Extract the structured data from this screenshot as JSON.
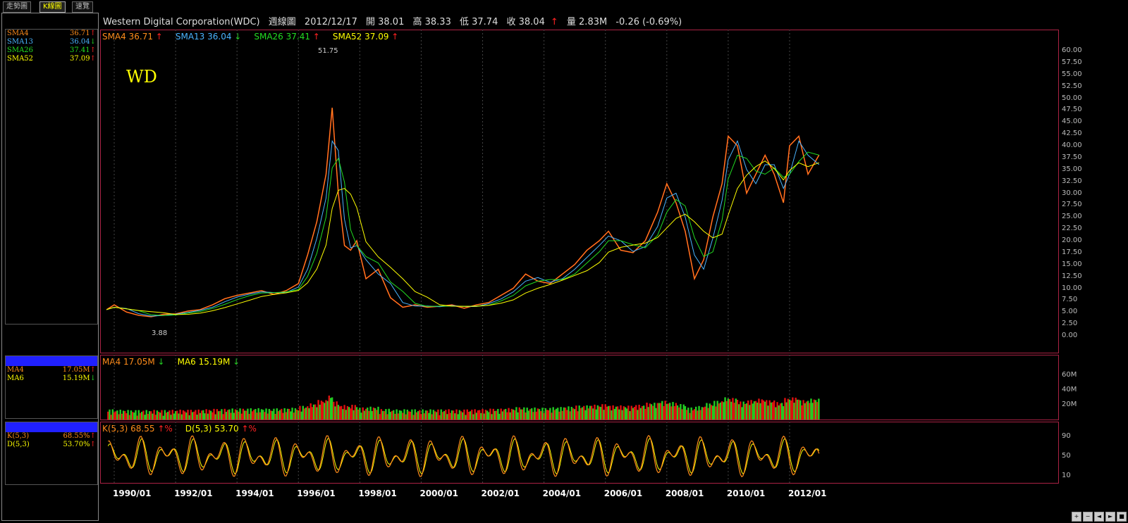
{
  "tabs": [
    "走勢圖",
    "K線圖",
    "速覽"
  ],
  "active_tab": 1,
  "header": {
    "company": "Western Digital Corporation(WDC)",
    "chart_type": "週線圖",
    "date": "2012/12/17",
    "open": "開 38.01",
    "high": "高 38.33",
    "low": "低 37.74",
    "close": "收 38.04",
    "volume": "量 2.83M",
    "change": "-0.26 (-0.69%)"
  },
  "ticker_watermark": "WD",
  "price_legend": [
    {
      "name": "SMA4",
      "value": "36.71",
      "dir": "up",
      "color": "#ff8c1a"
    },
    {
      "name": "SMA13",
      "value": "36.04",
      "dir": "down",
      "color": "#4ab4ff"
    },
    {
      "name": "SMA26",
      "value": "37.41",
      "dir": "up",
      "color": "#22dd22"
    },
    {
      "name": "SMA52",
      "value": "37.09",
      "dir": "up",
      "color": "#ffff00"
    }
  ],
  "volume_legend": [
    {
      "name": "MA4",
      "value": "17.05M",
      "dir": "down",
      "color": "#ff8c1a"
    },
    {
      "name": "MA6",
      "value": "15.19M",
      "dir": "down",
      "color": "#ffff00"
    }
  ],
  "kd_legend": [
    {
      "name": "K(5,3)",
      "value": "68.55",
      "dir": "up",
      "unit": "%",
      "color": "#ff8c1a"
    },
    {
      "name": "D(5,3)",
      "value": "53.70",
      "dir": "up",
      "unit": "%",
      "color": "#ffff00"
    }
  ],
  "left_panel": {
    "price_rows": [
      {
        "name": "SMA4",
        "value": "36.71",
        "dir": "up",
        "color": "#ff8c1a"
      },
      {
        "name": "SMA13",
        "value": "36.04",
        "dir": "down",
        "color": "#4ab4ff"
      },
      {
        "name": "SMA26",
        "value": "37.41",
        "dir": "up",
        "color": "#22dd22"
      },
      {
        "name": "SMA52",
        "value": "37.09",
        "dir": "up",
        "color": "#ffff00"
      }
    ],
    "volume_rows": [
      {
        "name": "MA4",
        "value": "17.05M",
        "dir": "up",
        "color": "#ff8c1a"
      },
      {
        "name": "MA6",
        "value": "15.19M",
        "dir": "down",
        "color": "#ffff00"
      }
    ],
    "kd_rows": [
      {
        "name": "K(5,3)",
        "value": "68.55%",
        "dir": "up",
        "color": "#ff8c1a"
      },
      {
        "name": "D(5,3)",
        "value": "53.70%",
        "dir": "up",
        "color": "#ffff00"
      }
    ]
  },
  "chart_data": {
    "type": "line",
    "x_ticks": [
      "1990/01",
      "1992/01",
      "1994/01",
      "1996/01",
      "1998/01",
      "2000/01",
      "2002/01",
      "2004/01",
      "2006/01",
      "2008/01",
      "2010/01",
      "2012/01"
    ],
    "price_axis": {
      "ylim": [
        0,
        60
      ],
      "ticks": [
        "0.00",
        "2.50",
        "5.00",
        "7.50",
        "10.00",
        "12.50",
        "15.00",
        "17.50",
        "20.00",
        "22.50",
        "25.00",
        "27.50",
        "30.00",
        "32.50",
        "35.00",
        "37.50",
        "40.00",
        "42.50",
        "45.00",
        "47.50",
        "50.00",
        "52.50",
        "55.00",
        "57.50",
        "60.00"
      ]
    },
    "volume_axis": {
      "ticks": [
        "20M",
        "40M",
        "60M"
      ],
      "ylim": [
        0,
        70
      ]
    },
    "kd_axis": {
      "ticks": [
        "10",
        "50",
        "90"
      ],
      "ylim": [
        0,
        100
      ]
    },
    "annotations": {
      "peak": "51.75",
      "trough": "3.88"
    },
    "price_series": {
      "years": [
        1989.75,
        1990.0,
        1990.4,
        1990.8,
        1991.2,
        1991.6,
        1992.0,
        1992.4,
        1992.8,
        1993.2,
        1993.6,
        1994.0,
        1994.4,
        1994.8,
        1995.2,
        1995.6,
        1996.0,
        1996.3,
        1996.6,
        1996.9,
        1997.1,
        1997.3,
        1997.5,
        1997.7,
        1997.9,
        1998.2,
        1998.6,
        1999.0,
        1999.4,
        1999.8,
        2000.2,
        2000.6,
        2001.0,
        2001.4,
        2001.8,
        2002.2,
        2002.6,
        2003.0,
        2003.4,
        2003.8,
        2004.2,
        2004.6,
        2005.0,
        2005.4,
        2005.8,
        2006.1,
        2006.5,
        2006.9,
        2007.3,
        2007.7,
        2008.0,
        2008.3,
        2008.6,
        2008.9,
        2009.2,
        2009.5,
        2009.8,
        2010.0,
        2010.3,
        2010.6,
        2010.9,
        2011.2,
        2011.5,
        2011.8,
        2012.0,
        2012.3,
        2012.6,
        2012.96
      ],
      "close": [
        5.5,
        6.5,
        5.0,
        4.3,
        4.0,
        4.5,
        4.6,
        5.2,
        5.5,
        6.5,
        7.8,
        8.5,
        9.0,
        9.5,
        8.7,
        9.5,
        11.0,
        17.0,
        24.0,
        34.0,
        48.0,
        30.0,
        19.0,
        18.0,
        20.0,
        12.0,
        14.0,
        8.0,
        6.0,
        6.5,
        6.0,
        6.2,
        6.5,
        5.8,
        6.5,
        7.0,
        8.5,
        10.0,
        13.0,
        11.5,
        11.0,
        13.0,
        15.0,
        18.0,
        20.0,
        22.0,
        18.0,
        17.5,
        20.0,
        26.0,
        32.0,
        28.0,
        22.0,
        12.0,
        16.0,
        25.0,
        32.0,
        42.0,
        40.0,
        30.0,
        34.0,
        38.0,
        34.0,
        28.0,
        40.0,
        42.0,
        34.0,
        38.04
      ]
    }
  }
}
